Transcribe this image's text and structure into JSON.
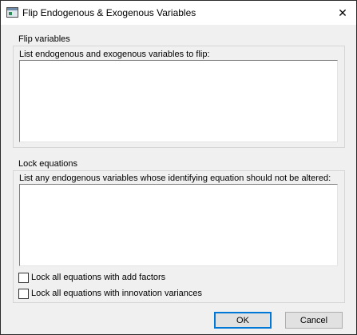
{
  "window": {
    "title": "Flip Endogenous & Exogenous Variables",
    "close_glyph": "✕"
  },
  "flip_group": {
    "label": "Flip variables",
    "instruction": "List endogenous and exogenous variables to flip:",
    "value": ""
  },
  "lock_group": {
    "label": "Lock equations",
    "instruction": "List any endogenous variables whose identifying equation should not be altered:",
    "value": ""
  },
  "checkboxes": {
    "add_factors": {
      "label": "Lock all equations with add factors",
      "checked": false
    },
    "innovation_variances": {
      "label": "Lock all equations with innovation variances",
      "checked": false
    }
  },
  "buttons": {
    "ok": "OK",
    "cancel": "Cancel"
  },
  "icons": {
    "app": "window-app-icon",
    "close": "close-icon"
  }
}
